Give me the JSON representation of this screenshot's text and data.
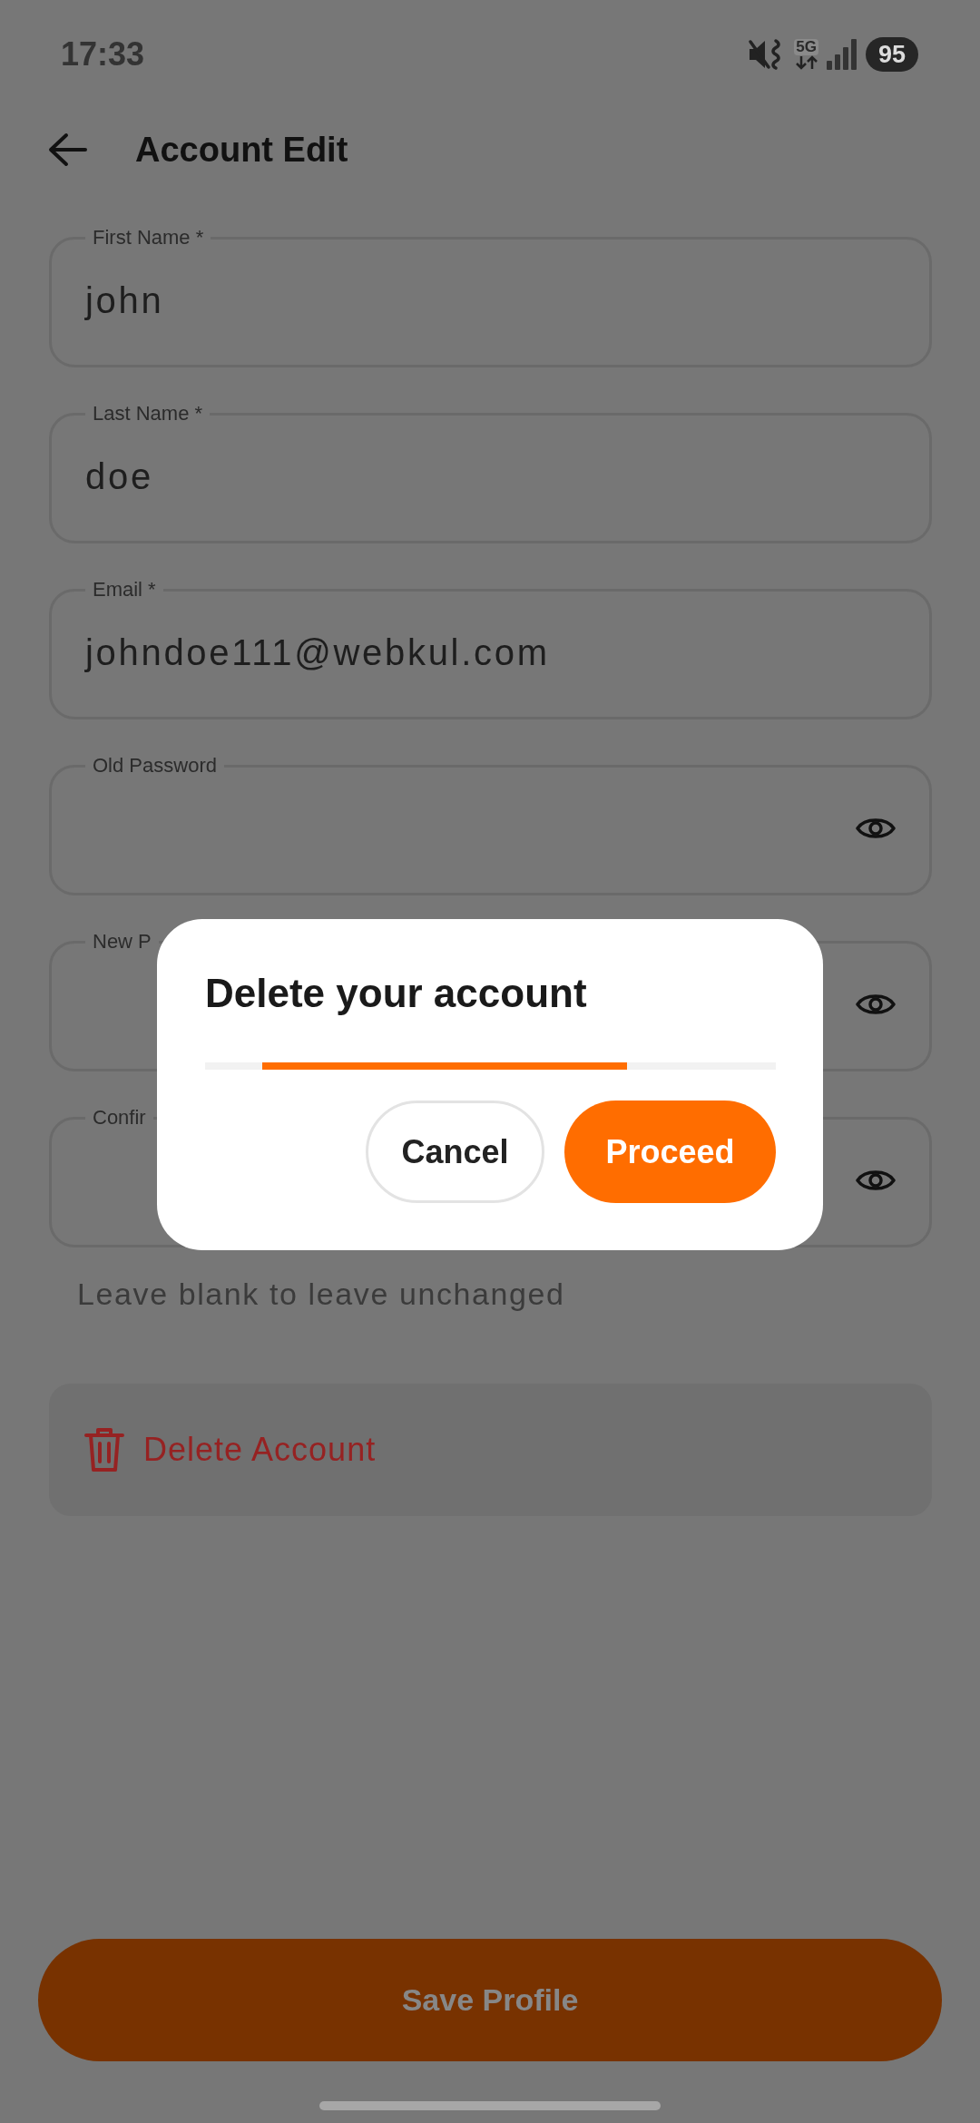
{
  "status_bar": {
    "time": "17:33",
    "network": "5G",
    "battery": "95"
  },
  "app_bar": {
    "title": "Account Edit"
  },
  "form": {
    "fields": [
      {
        "kind": "text",
        "label": "First Name *",
        "value": "john"
      },
      {
        "kind": "text",
        "label": "Last Name *",
        "value": "doe"
      },
      {
        "kind": "text",
        "label": "Email *",
        "value": "johndoe111@webkul.com"
      },
      {
        "kind": "password",
        "label": "Old Password"
      },
      {
        "kind": "password",
        "label": "New P"
      },
      {
        "kind": "password",
        "label": "Confir"
      }
    ],
    "helper": "Leave blank to leave unchanged"
  },
  "delete_account": {
    "label": "Delete Account"
  },
  "save_button": {
    "label": "Save Profile"
  },
  "dialog": {
    "title": "Delete your account",
    "progress": {
      "indeterminate": true
    },
    "buttons": [
      {
        "kind": "cancel",
        "label": "Cancel"
      },
      {
        "kind": "confirm",
        "label": "Proceed"
      }
    ]
  }
}
